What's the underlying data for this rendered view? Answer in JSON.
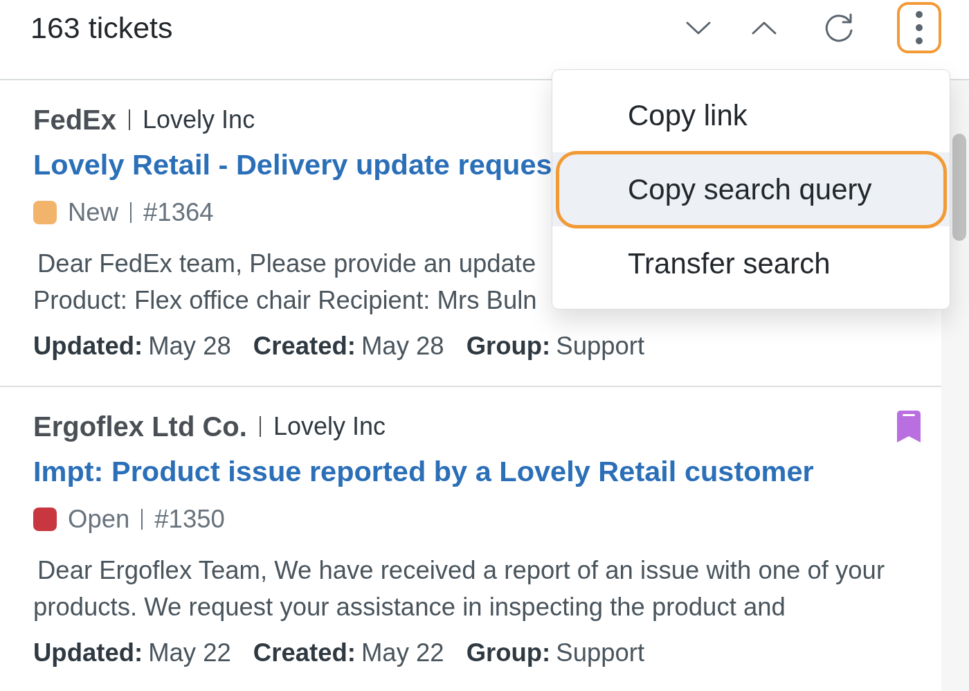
{
  "header": {
    "ticket_count": "163 tickets",
    "more_button": {
      "focused": true
    }
  },
  "menu": {
    "items": [
      {
        "label": "Copy link",
        "selected": false
      },
      {
        "label": "Copy search query",
        "selected": true
      },
      {
        "label": "Transfer search",
        "selected": false
      }
    ]
  },
  "tickets": [
    {
      "requester": "FedEx",
      "organization": "Lovely Inc",
      "title": "Lovely Retail - Delivery update reques",
      "status": {
        "label": "New",
        "color": "#f2b46b"
      },
      "number": "#1364",
      "description": [
        "Dear FedEx team, Please provide an update",
        "Product: Flex office chair Recipient: Mrs Buln"
      ],
      "meta": [
        {
          "label": "Updated:",
          "value": "May 28"
        },
        {
          "label": "Created:",
          "value": "May 28"
        },
        {
          "label": "Group:",
          "value": "Support"
        }
      ]
    },
    {
      "requester": "Ergoflex Ltd Co.",
      "organization": "Lovely Inc",
      "title": "Impt: Product issue reported by a Lovely Retail customer",
      "status": {
        "label": "Open",
        "color": "#c8363f"
      },
      "number": "#1350",
      "bookmarked": true,
      "description": [
        "Dear Ergoflex Team, We have received a report of an issue with one of your",
        "products. We request your assistance in inspecting the product and"
      ],
      "meta": [
        {
          "label": "Updated:",
          "value": "May 22"
        },
        {
          "label": "Created:",
          "value": "May 22"
        },
        {
          "label": "Group:",
          "value": "Support"
        }
      ]
    }
  ]
}
